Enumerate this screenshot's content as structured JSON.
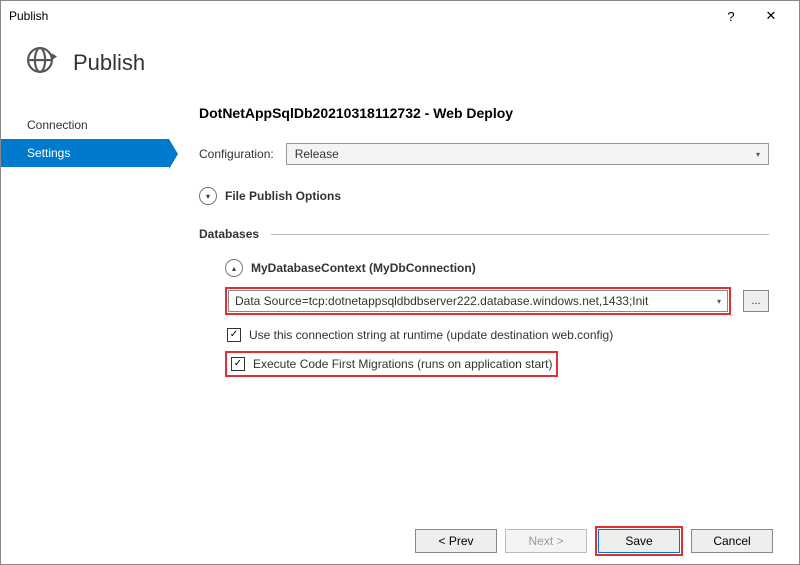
{
  "window": {
    "title": "Publish",
    "help": "?",
    "close": "✕"
  },
  "header": {
    "title": "Publish"
  },
  "sidebar": {
    "items": [
      {
        "label": "Connection"
      },
      {
        "label": "Settings"
      }
    ]
  },
  "main": {
    "profile_title": "DotNetAppSqlDb20210318112732 - Web Deploy",
    "config_label": "Configuration:",
    "config_value": "Release",
    "file_publish_title": "File Publish Options",
    "databases_title": "Databases",
    "dbcontext_title": "MyDatabaseContext (MyDbConnection)",
    "conn_value": "Data Source=tcp:dotnetappsqldbdbserver222.database.windows.net,1433;Init",
    "conn_more": "...",
    "chk_use_conn": "Use this connection string at runtime (update destination web.config)",
    "chk_exec_migrations": "Execute Code First Migrations (runs on application start)"
  },
  "footer": {
    "prev": "< Prev",
    "next": "Next >",
    "save": "Save",
    "cancel": "Cancel"
  }
}
